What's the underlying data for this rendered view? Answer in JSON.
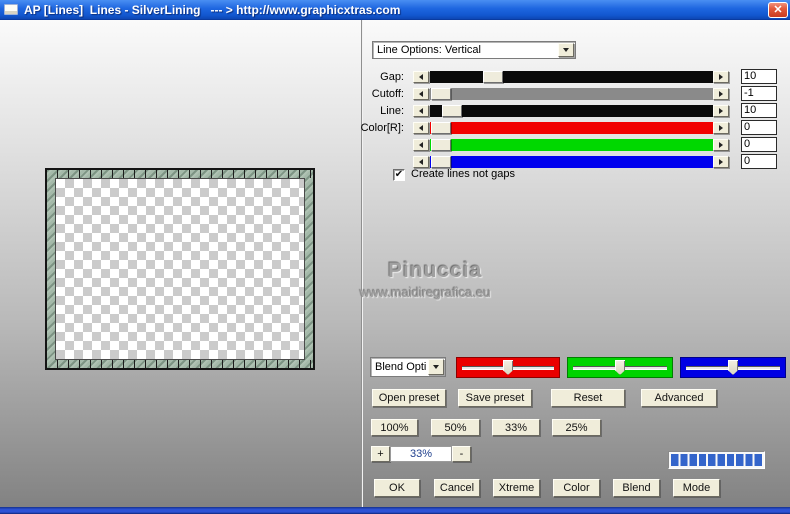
{
  "window": {
    "title": "AP [Lines]  Lines - SilverLining   --- > http://www.graphicxtras.com",
    "close_icon": "✕"
  },
  "colors": {
    "titlebar_blue": "#1e66e0",
    "button_face": "#f0edda",
    "segment_blue": "#3465cb"
  },
  "panel": {
    "line_options_combo": {
      "value": "Line Options: Vertical"
    },
    "sliders": [
      {
        "label": "Gap:",
        "value": "10",
        "track_color": "#0a0a0a"
      },
      {
        "label": "Cutoff:",
        "value": "-1",
        "track_color": "#8a8a8a"
      },
      {
        "label": "Line:",
        "value": "10",
        "track_color": "#0a0a0a"
      },
      {
        "label": "Color[R]:",
        "value": "0",
        "track_color": "#f10000"
      },
      {
        "label": "",
        "value": "0",
        "track_color": "#00d800"
      },
      {
        "label": "",
        "value": "0",
        "track_color": "#0000ee"
      }
    ],
    "checkbox": {
      "label": "Create lines not gaps",
      "checked": true,
      "glyph": "✔"
    },
    "watermark": {
      "title": "Pinuccia",
      "url": "www.maidiregrafica.eu"
    },
    "blend_combo": {
      "value": "Blend Opti"
    },
    "rgb_trackbars": [
      {
        "name": "red",
        "color": "#ea0000"
      },
      {
        "name": "green",
        "color": "#00d400"
      },
      {
        "name": "blue",
        "color": "#0000e4"
      }
    ],
    "preset_buttons": [
      "Open preset",
      "Save preset",
      "Reset",
      "Advanced"
    ],
    "percent_buttons": [
      "100%",
      "50%",
      "33%",
      "25%"
    ],
    "zoom_control": {
      "plus": "+",
      "value": "33%",
      "minus": "-"
    },
    "action_buttons": [
      "OK",
      "Cancel",
      "Xtreme",
      "Color",
      "Blend",
      "Mode"
    ]
  }
}
